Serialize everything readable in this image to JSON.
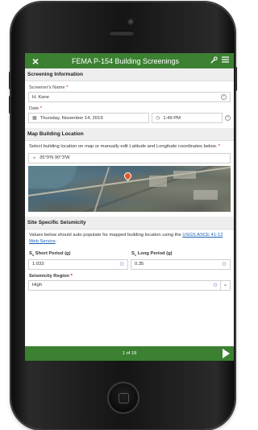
{
  "app": {
    "title": "FEMA P-154 Building Screenings",
    "close_icon": "×",
    "tool_icon": "wrench-icon",
    "menu_icon": "hamburger-menu-icon"
  },
  "sections": {
    "screening_info": "Screening Information",
    "map_location": "Map Building Location",
    "site_seismicity": "Site Specific Seismicity"
  },
  "screener": {
    "label": "Screener's Name",
    "required_mark": "*",
    "value": "H. Kane"
  },
  "date": {
    "label": "Date",
    "required_mark": "*",
    "date_value": "Thursday, November 14, 2019",
    "time_value": "1:49 PM"
  },
  "map": {
    "description": "Select building location on map or manually edit Latitude and Longitude coordinates below.",
    "required_mark": "*",
    "coordinates": "35°9'N 90°3'W"
  },
  "seismicity": {
    "description_prefix": "Values below should auto populate for mapped building location using the ",
    "link_text": "USGS ASCE 41-13 Web Service",
    "description_suffix": ".",
    "short_period_label": "Short Period (g)",
    "long_period_label": "Long Period (g)",
    "short_period_value": "1.033",
    "long_period_value": "0.35",
    "s_symbol": "S",
    "s_sub": "s",
    "l_sub": "1"
  },
  "region": {
    "label": "Seismicity Region",
    "required_mark": "*",
    "value": "High"
  },
  "pager": {
    "text": "1 of 18"
  },
  "colors": {
    "bar_green": "#3b8131",
    "link_blue": "#1a5fb4"
  }
}
